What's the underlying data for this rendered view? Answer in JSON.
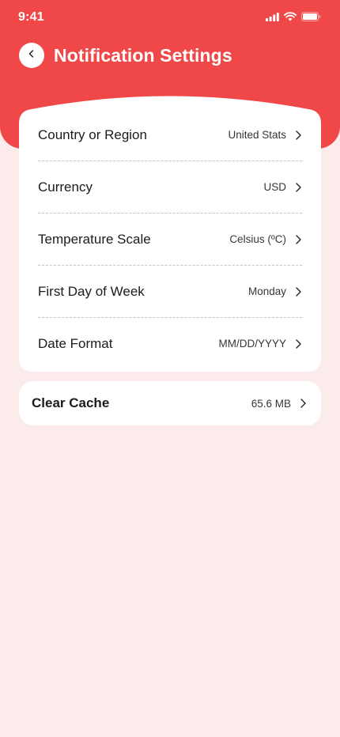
{
  "status_bar": {
    "time": "9:41"
  },
  "header": {
    "title": "Notification Settings"
  },
  "settings": [
    {
      "label": "Country or Region",
      "value": "United Stats"
    },
    {
      "label": "Currency",
      "value": "USD"
    },
    {
      "label": "Temperature Scale",
      "value": "Celsius (ºC)"
    },
    {
      "label": "First Day of Week",
      "value": "Monday"
    },
    {
      "label": "Date Format",
      "value": "MM/DD/YYYY"
    }
  ],
  "cache": {
    "label": "Clear Cache",
    "value": "65.6 MB"
  },
  "colors": {
    "accent": "#f04848",
    "background": "#fbeceb",
    "card": "#ffffff"
  },
  "icons": [
    "chevron-left-icon",
    "chevron-right-icon",
    "signal-icon",
    "wifi-icon",
    "battery-icon"
  ]
}
